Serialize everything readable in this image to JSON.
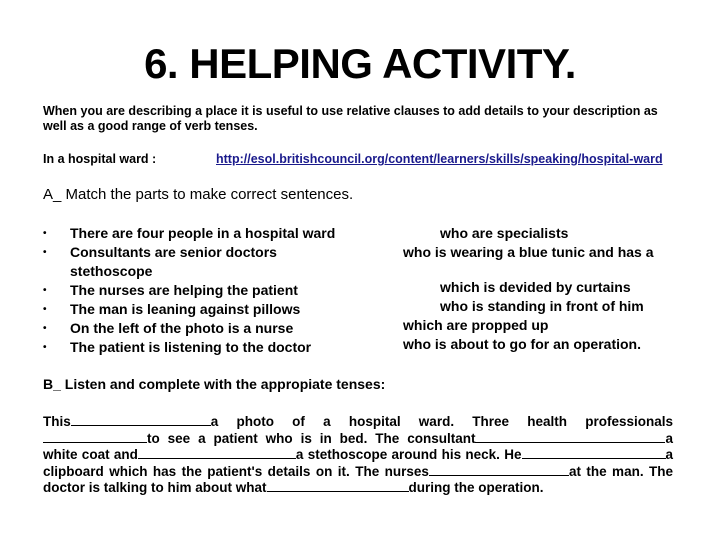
{
  "title": "6. HELPING ACTIVITY.",
  "intro": "When you are describing a place it is useful to use relative clauses to add details to your description as well as a good range of verb tenses.",
  "ward": {
    "label": "In a hospital ward :",
    "link": "http://esol.britishcouncil.org/content/learners/skills/speaking/hospital-ward",
    "link_color": "#1a1a8c"
  },
  "section_a": {
    "heading": "A_ Match the parts to make correct sentences.",
    "left_items": [
      "There are four people in a hospital ward",
      "Consultants are senior doctors stethoscope",
      "The nurses are helping the patient",
      "The man is leaning against pillows",
      "On the left of the photo is a nurse",
      "The patient is listening to the doctor"
    ],
    "right_items": [
      "who are specialists",
      "who is wearing a blue tunic and has a",
      "which is devided by curtains",
      "who is standing in front of him",
      "which are propped up",
      "who is about to go for an operation."
    ],
    "bullet": "•"
  },
  "section_b": {
    "heading": "B_ Listen and complete with the appropiate tenses:",
    "segments": {
      "s1": "This",
      "s2": "a photo of a hospital ward. Three health professionals",
      "s3": "to see a patient who is in bed. The consultant",
      "s4": "a",
      "s5": "white coat and",
      "s6": "a stethoscope around his neck. He",
      "s7": "a",
      "s8": "clipboard which has the patient's details on it. The nurses",
      "s9": "at the man. The",
      "s10": "doctor is talking to him about what",
      "s11": "during the operation."
    }
  }
}
